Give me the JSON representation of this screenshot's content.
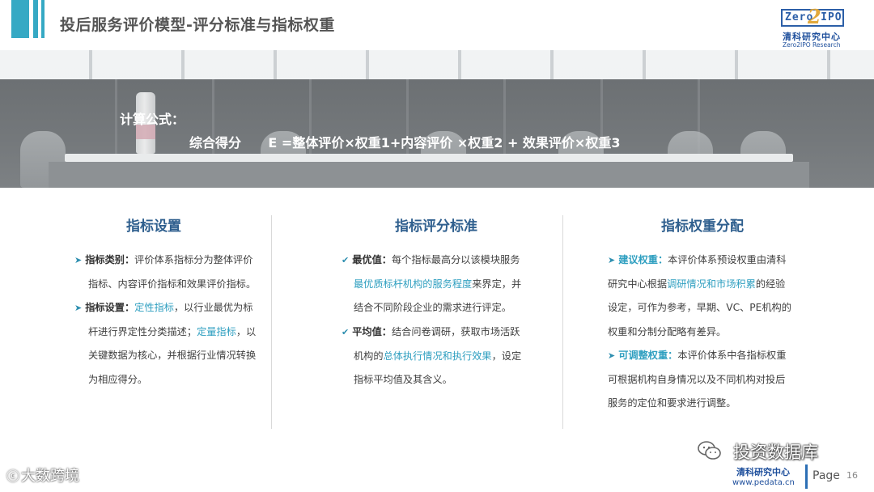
{
  "header": {
    "title": "投后服务评价模型-评分标准与指标权重",
    "logo_box_text": "Zero IPO",
    "logo_2": "2",
    "logo_cn": "清科研究中心",
    "logo_en": "Zero2IPO Research"
  },
  "banner": {
    "label": "计算公式：",
    "formula": "综合得分      E =整体评价×权重1+内容评价 ×权重2 + 效果评价×权重3"
  },
  "columns": [
    {
      "title": "指标设置",
      "items": [
        {
          "mark": "➤",
          "key": "指标类别：",
          "lines": [
            "评价体系指标分为整体评价",
            "指标、内容评价指标和效果评价指标。"
          ]
        },
        {
          "mark": "➤",
          "key": "指标设置：",
          "hl1": "定性指标",
          "t1": "，以行业最优为标",
          "lines2": [
            "杆进行界定性分类描述；"
          ],
          "hl2": "定量指标",
          "t2": "，以",
          "lines3": [
            "关键数据为核心，并根据行业情况转换",
            "为相应得分。"
          ]
        }
      ]
    },
    {
      "title": "指标评分标准",
      "items": [
        {
          "mark": "✔",
          "key": "最优值：",
          "t1": "每个指标最高分以该模块服务",
          "hl1": "最优质标杆机构的服务程度",
          "t2": "来界定，并",
          "t3": "结合不同阶段企业的需求进行评定。"
        },
        {
          "mark": "✔",
          "key": "平均值：",
          "t1": "结合问卷调研，获取市场活跃",
          "t2": "机构的",
          "hl1": "总体执行情况和执行效果",
          "t3": "，设定",
          "t4": "指标平均值及其含义。"
        }
      ]
    },
    {
      "title": "指标权重分配",
      "items": [
        {
          "mark": "➤",
          "key": "建议权重：",
          "t1": "本评价体系预设权重由清科",
          "t2": "研究中心根据",
          "hl1": "调研情况和市场积累",
          "t3": "的经验",
          "t4": "设定，可作为参考，早期、VC、PE机构的",
          "t5": "权重和分制分配略有差异。"
        },
        {
          "mark": "➤",
          "key": "可调整权重：",
          "t1": "本评价体系中各指标权重",
          "t2": "可根据机构自身情况以及不同机构对投后",
          "t3": "服务的定位和要求进行调整。"
        }
      ]
    }
  ],
  "footer": {
    "wechat_text": "投资数据库",
    "corner_watermark": "大数跨境",
    "org_cn": "清科研究中心",
    "url": "www.pedata.cn",
    "page_label": "Page",
    "page_number": "16"
  },
  "colors": {
    "accent": "#36a9c4",
    "title_blue": "#2f5f8e",
    "highlight": "#2f9fc0",
    "brand_blue": "#1e4f9c"
  }
}
